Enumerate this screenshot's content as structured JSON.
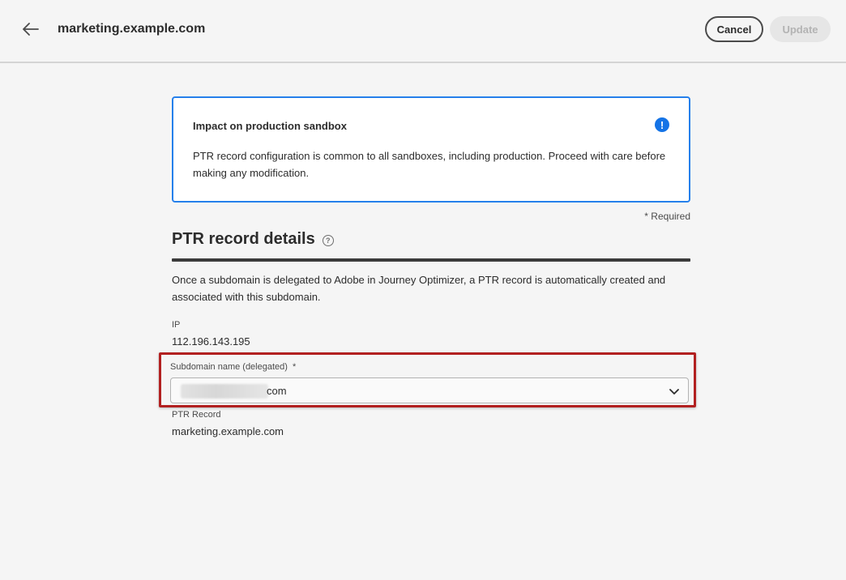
{
  "header": {
    "title": "marketing.example.com",
    "back_icon": "arrow-left-icon",
    "cancel_label": "Cancel",
    "update_label": "Update"
  },
  "alert": {
    "title": "Impact on production sandbox",
    "icon": "exclamation-icon",
    "body": "PTR record configuration is common to all sandboxes, including production. Proceed with care before making any modification.",
    "accent_color": "#2680eb"
  },
  "required_note": "* Required",
  "section": {
    "title": "PTR record details",
    "help_icon": "help-circle-icon",
    "description": "Once a subdomain is delegated to Adobe in Journey Optimizer, a PTR record is automatically created and associated with this subdomain."
  },
  "ip": {
    "label": "IP",
    "value": "112.196.143.195"
  },
  "subdomain": {
    "label": "Subdomain name (delegated)",
    "required_marker": "*",
    "value_suffix": "com",
    "chevron_icon": "chevron-down-icon",
    "highlight_color": "#b22020"
  },
  "ptr_record": {
    "label": "PTR Record",
    "value": "marketing.example.com"
  }
}
